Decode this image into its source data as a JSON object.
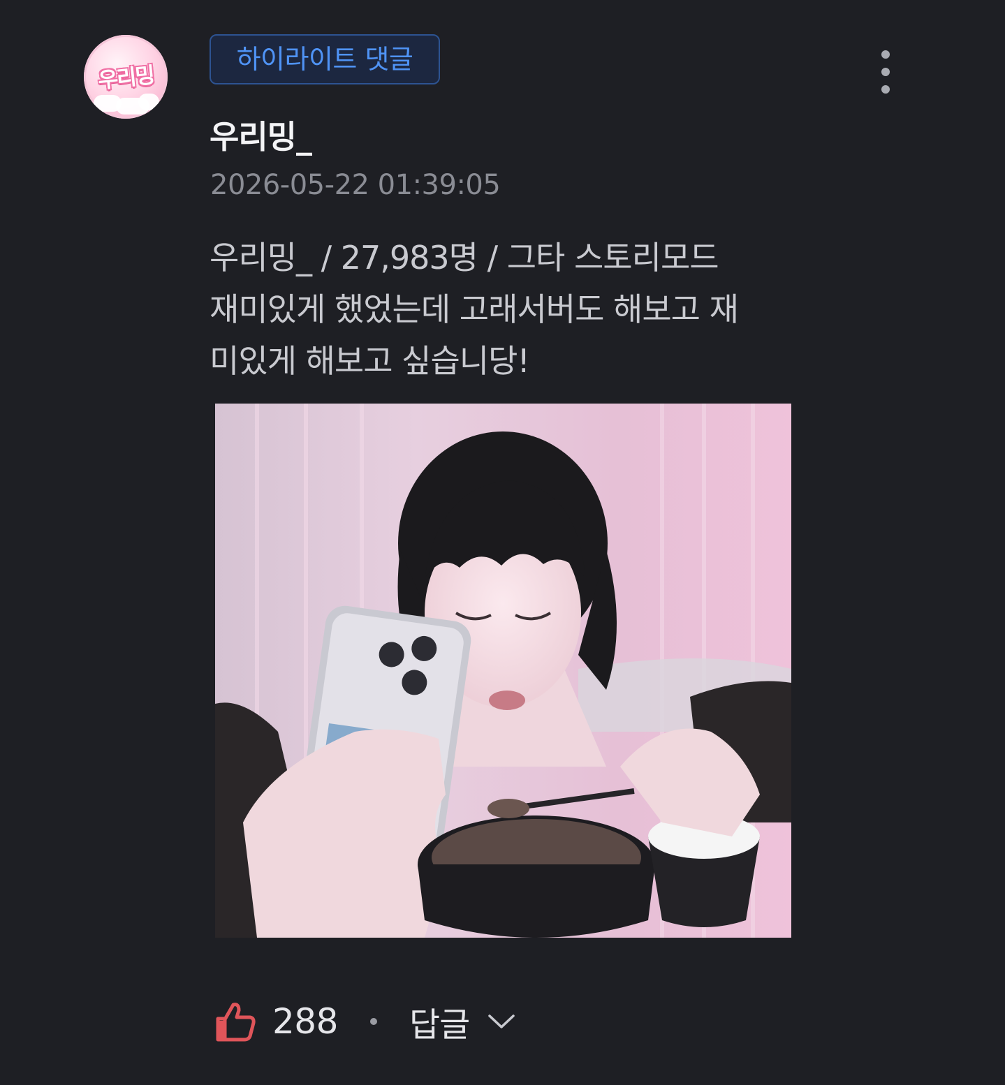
{
  "comment": {
    "avatar_text": "우리밍",
    "badge": "하이라이트 댓글",
    "author": "우리밍_",
    "timestamp": "2026-05-22 01:39:05",
    "body_lines": [
      "우리밍_ / 27,983명 / 그타 스토리모드",
      "재미있게 했었는데 고래서버도 해보고 재",
      "미있게 해보고 싶습니당!"
    ],
    "like_count": "288",
    "reply_label": "답글"
  },
  "icons": {
    "more": "vertical-dots-icon",
    "like": "thumbs-up-icon",
    "reply_toggle": "chevron-down-icon"
  },
  "colors": {
    "background": "#1e1f24",
    "badge_text": "#4f93f5",
    "badge_border": "#2d5391",
    "like_icon": "#e0555a",
    "muted_text": "#8a8c94"
  }
}
